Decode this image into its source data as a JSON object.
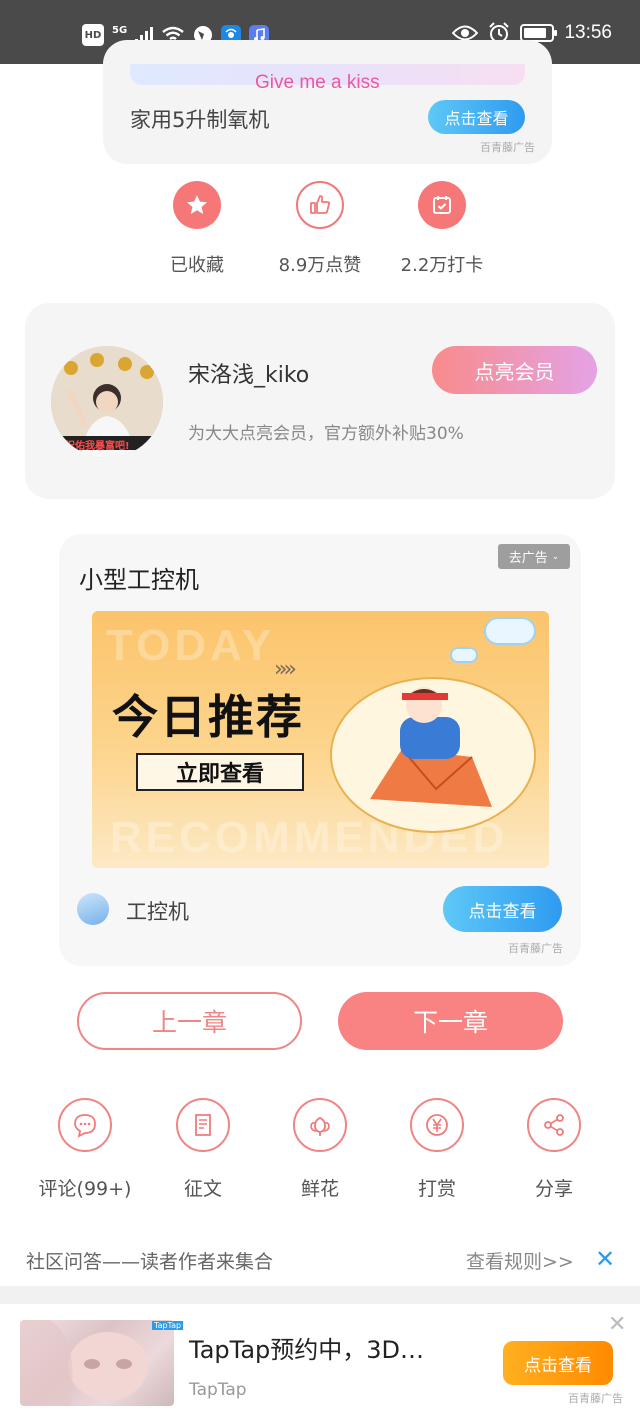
{
  "status_bar": {
    "hd_label": "HD",
    "network": "5G",
    "time": "13:56",
    "icons": [
      "hd-icon",
      "signal-icon",
      "wifi-icon",
      "browser-icon",
      "app-icon",
      "music-icon",
      "eye-icon",
      "alarm-icon",
      "battery-icon"
    ]
  },
  "top_ad": {
    "image_text": "Give me a kiss",
    "title": "家用5升制氧机",
    "button": "点击查看",
    "ad_mark": "百青藤广告"
  },
  "actions": [
    {
      "label": "已收藏",
      "icon": "star-icon",
      "color": "#f07a7a"
    },
    {
      "label": "8.9万点赞",
      "icon": "thumbs-up-icon",
      "color": "#f07a7a"
    },
    {
      "label": "2.2万打卡",
      "icon": "calendar-check-icon",
      "color": "#f07a7a"
    }
  ],
  "member_card": {
    "name": "宋洛浅_kiko",
    "subtitle": "为大大点亮会员，官方额外补贴30%",
    "button": "点亮会员",
    "avatar_caption": "祝佑我暴富吧!"
  },
  "mid_ad": {
    "title": "小型工控机",
    "remove_ad": "去广告",
    "banner_bg_top": "TODAY",
    "banner_bg_bottom": "RECOMMENDED",
    "banner_main": "今日推荐",
    "banner_sub": "立即查看",
    "advertiser": "工控机",
    "button": "点击查看",
    "ad_mark": "百青藤广告"
  },
  "chapter_nav": {
    "prev": "上一章",
    "next": "下一章"
  },
  "tools": [
    {
      "label": "评论(99+)",
      "icon": "comment-icon"
    },
    {
      "label": "征文",
      "icon": "document-icon"
    },
    {
      "label": "鲜花",
      "icon": "flower-icon"
    },
    {
      "label": "打赏",
      "icon": "yen-icon"
    },
    {
      "label": "分享",
      "icon": "share-icon"
    }
  ],
  "community": {
    "text": "社区问答——读者作者来集合",
    "rules": "查看规则>>",
    "close": "✕"
  },
  "bottom_ad": {
    "title": "TapTap预约中，3D…",
    "source": "TapTap",
    "button": "点击查看",
    "ad_mark": "百青藤广告",
    "image_tag": "TapTap",
    "close": "✕"
  }
}
